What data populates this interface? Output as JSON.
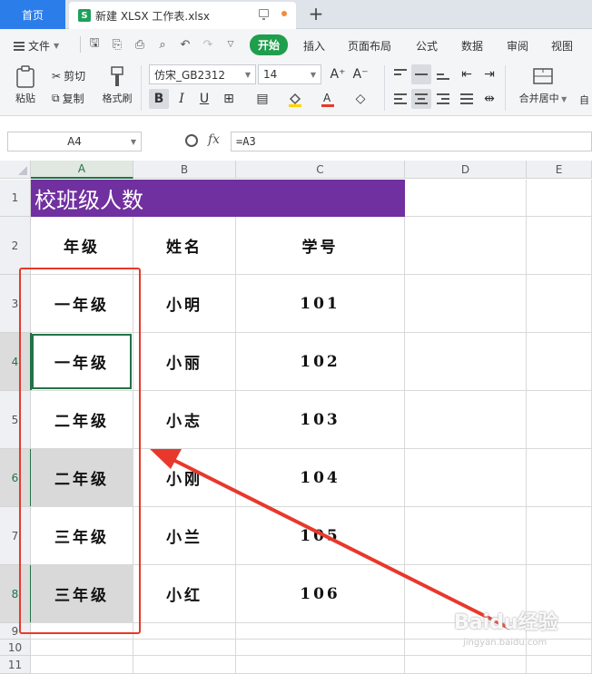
{
  "tabbar": {
    "home_label": "首页",
    "doc_icon": "S",
    "doc_title": "新建 XLSX 工作表.xlsx",
    "new_tab": "+"
  },
  "menubar": {
    "file_label": "文件",
    "start_label": "开始",
    "items": [
      "插入",
      "页面布局",
      "公式",
      "数据",
      "审阅",
      "视图"
    ]
  },
  "ribbon": {
    "paste_label": "粘贴",
    "cut_label": "剪切",
    "copy_label": "复制",
    "format_painter_label": "格式刷",
    "font_name": "仿宋_GB2312",
    "font_size": "14",
    "bold": "B",
    "italic": "I",
    "underline": "U",
    "grow_font": "A⁺",
    "shrink_font": "A⁻",
    "merge_center_label": "合并居中",
    "more_label": "自"
  },
  "formula_bar": {
    "name_box": "A4",
    "fx": "fx",
    "formula": "=A3"
  },
  "grid": {
    "columns": [
      "A",
      "B",
      "C",
      "D",
      "E"
    ],
    "rows": [
      "1",
      "2",
      "3",
      "4",
      "5",
      "6",
      "7",
      "8",
      "9",
      "10",
      "11"
    ],
    "title": "校班级人数",
    "header": [
      "年级",
      "姓名",
      "学号"
    ],
    "data": [
      [
        "一年级",
        "小明",
        "101"
      ],
      [
        "一年级",
        "小丽",
        "102"
      ],
      [
        "二年级",
        "小志",
        "103"
      ],
      [
        "二年级",
        "小刚",
        "104"
      ],
      [
        "三年级",
        "小兰",
        "105"
      ],
      [
        "三年级",
        "小红",
        "106"
      ]
    ]
  },
  "watermark": {
    "logo": "Baidu经验",
    "url": "jingyan.baidu.com"
  }
}
